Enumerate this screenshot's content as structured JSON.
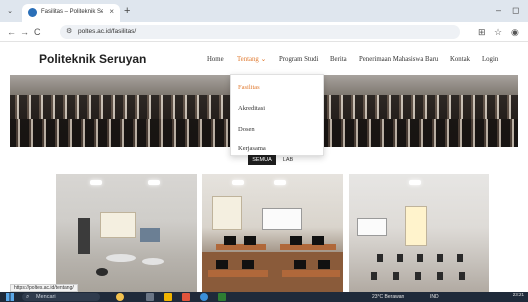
{
  "browser": {
    "tab_title": "Fasilitas – Politeknik Seruyan",
    "tab_close": "×",
    "new_tab": "+",
    "minimize": "–",
    "maximize": "◻",
    "url": "poltes.ac.id/fasilitas/",
    "nav": {
      "back": "←",
      "forward": "→",
      "reload": "C"
    }
  },
  "site": {
    "logo": "Politeknik Seruyan",
    "nav": [
      {
        "label": "Home"
      },
      {
        "label": "Tentang ⌄"
      },
      {
        "label": "Program Studi"
      },
      {
        "label": "Berita"
      },
      {
        "label": "Penerimaan Mahasiswa Baru"
      },
      {
        "label": "Kontak"
      },
      {
        "label": "Login"
      }
    ],
    "dropdown": [
      {
        "label": "Fasilitas"
      },
      {
        "label": "Akreditasi"
      },
      {
        "label": "Dosen"
      },
      {
        "label": "Kerjasama"
      }
    ],
    "filters": [
      {
        "label": "SEMUA"
      },
      {
        "label": "LAB"
      }
    ]
  },
  "status_url": "https://poltes.ac.id/tentang/",
  "taskbar": {
    "search_placeholder": "Mencari",
    "weather": "23°C Berawan",
    "tray": "IND",
    "time": "23:21"
  },
  "colors": {
    "accent": "#e07a30",
    "taskbar": "#1f2a3a"
  }
}
